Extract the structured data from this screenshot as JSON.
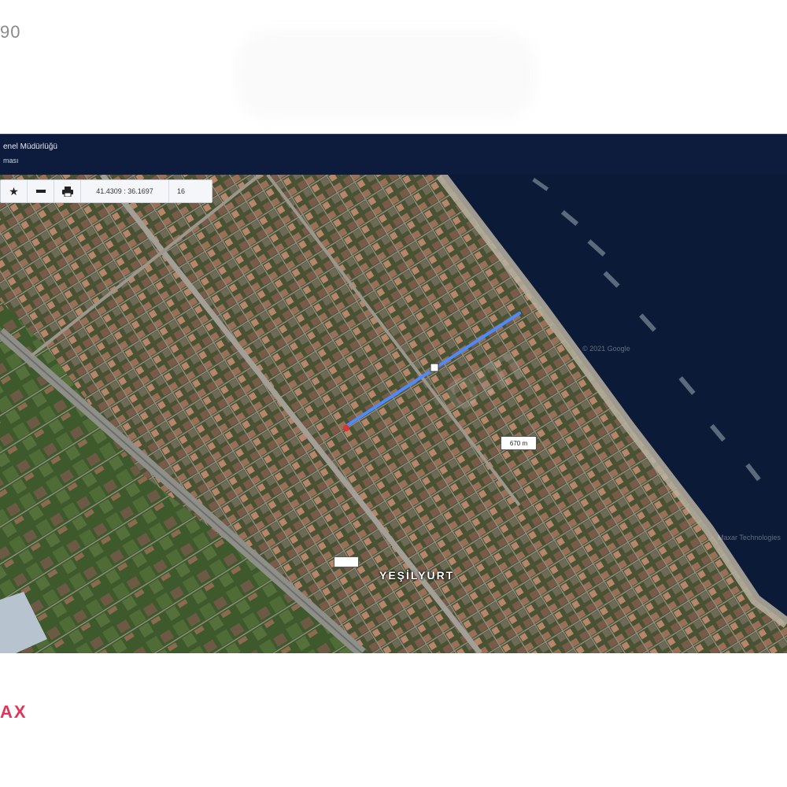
{
  "page": {
    "corner_number": "90",
    "brand_text": "AX"
  },
  "header": {
    "line1": "enel Müdürlüğü",
    "line2": "ması"
  },
  "toolbar": {
    "favorite_icon": "star-icon",
    "measure_icon": "minus-icon",
    "print_icon": "printer-icon",
    "coordinates": "41.4309 : 36.1697",
    "zoom_level": "16"
  },
  "map": {
    "distance_label": "670 m",
    "start_marker_label": "",
    "place_name": "YEŞİLYURT",
    "watermark": "om",
    "copyright_1": "© 2021 Google",
    "copyright_2": "Maxar Technologies",
    "colors": {
      "measure_line": "#4a8cff",
      "sea": "#0b1a36",
      "land": "#4b5636"
    }
  }
}
